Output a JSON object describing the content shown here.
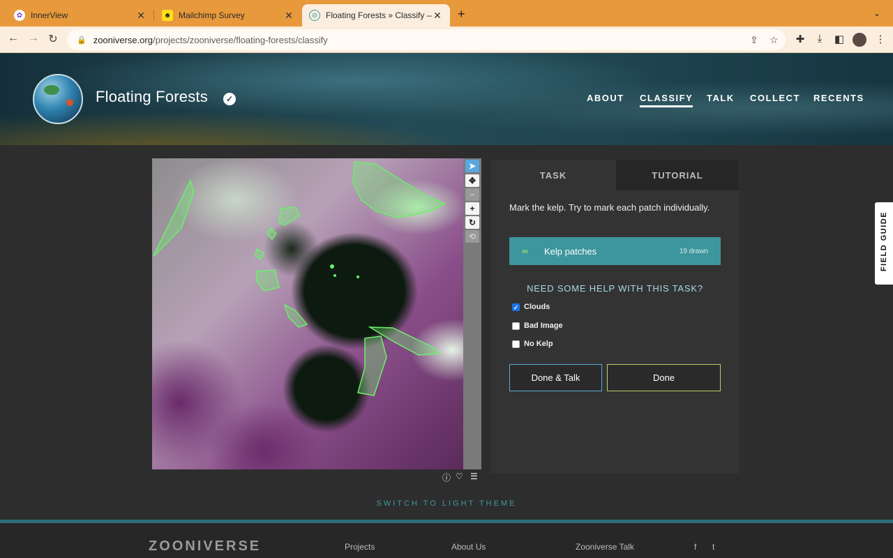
{
  "browser": {
    "tabs": [
      {
        "title": "InnerView",
        "favicon": "innerview-icon"
      },
      {
        "title": "Mailchimp Survey",
        "favicon": "mailchimp-icon"
      },
      {
        "title": "Floating Forests » Classify — Z",
        "favicon": "zooniverse-icon"
      }
    ],
    "url_host": "zooniverse.org",
    "url_path": "/projects/zooniverse/floating-forests/classify"
  },
  "header": {
    "project_title": "Floating Forests",
    "nav": [
      "ABOUT",
      "CLASSIFY",
      "TALK",
      "COLLECT",
      "RECENTS"
    ],
    "active_nav": "CLASSIFY"
  },
  "viewer": {
    "tools": [
      "pointer",
      "pan",
      "zoom-out",
      "zoom-in",
      "rotate",
      "reset"
    ]
  },
  "task_panel": {
    "tabs": {
      "task": "TASK",
      "tutorial": "TUTORIAL"
    },
    "instruction": "Mark the kelp. Try to mark each patch individually.",
    "tool": {
      "label": "Kelp patches",
      "count": "19 drawn"
    },
    "help_heading": "NEED SOME HELP WITH THIS TASK?",
    "checkboxes": [
      {
        "label": "Clouds",
        "checked": true
      },
      {
        "label": "Bad Image",
        "checked": false
      },
      {
        "label": "No Kelp",
        "checked": false
      }
    ],
    "buttons": {
      "done_talk": "Done & Talk",
      "done": "Done"
    }
  },
  "field_guide": "FIELD GUIDE",
  "theme_switch": "SWITCH TO LIGHT THEME",
  "footer": {
    "logo": "ZOONIVERSE",
    "links": [
      "Projects",
      "About Us",
      "Zooniverse Talk"
    ]
  },
  "colors": {
    "accent": "#3d969d",
    "kelp_outline": "#6cf06c",
    "tab_bar": "#e8993b"
  }
}
